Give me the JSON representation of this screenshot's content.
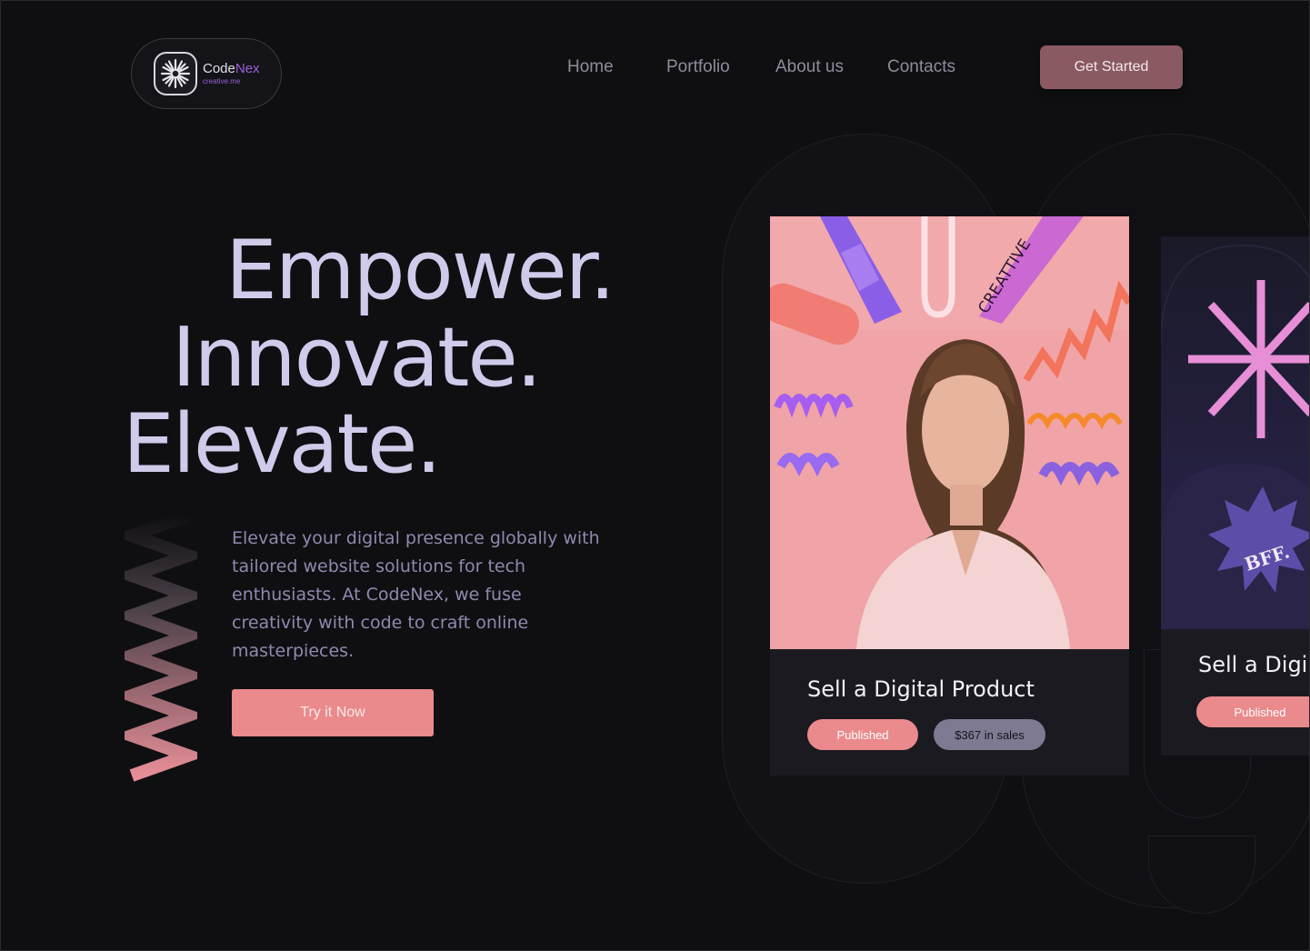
{
  "brand": {
    "name_part1": "Code",
    "name_part2": "Nex",
    "tagline": "creative.me"
  },
  "nav": {
    "items": [
      {
        "label": "Home"
      },
      {
        "label": "Portfolio"
      },
      {
        "label": "About us"
      },
      {
        "label": "Contacts"
      }
    ]
  },
  "header": {
    "cta_label": "Get Started"
  },
  "hero": {
    "lines": [
      "Empower.",
      "Innovate.",
      "Elevate."
    ],
    "description": "Elevate your digital presence globally with tailored website solutions for tech enthusiasts. At CodeNex, we fuse creativity with code to craft online masterpieces.",
    "cta_label": "Try it Now"
  },
  "cards": [
    {
      "title": "Sell a Digital Product",
      "status": "Published",
      "sales": "$367 in sales",
      "image_text": "CREATTIVE"
    },
    {
      "title": "Sell a Digi",
      "status": "Published",
      "image_text": "BFF."
    }
  ],
  "colors": {
    "background": "#0f0f12",
    "accent_pink": "#ea8a8c",
    "accent_purple": "#9b5fd8",
    "hero_text": "#cfcbea",
    "cta_dark": "#8a5962"
  }
}
